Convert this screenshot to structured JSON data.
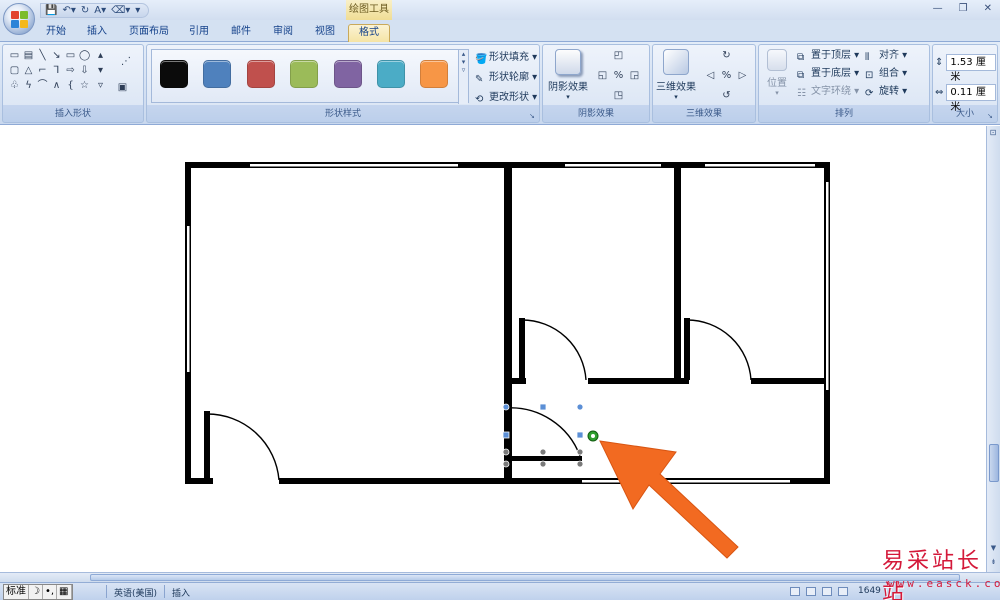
{
  "title_bar": {
    "context_tool_label": "绘图工具"
  },
  "tabs": [
    {
      "label": "开始"
    },
    {
      "label": "插入"
    },
    {
      "label": "页面布局"
    },
    {
      "label": "引用"
    },
    {
      "label": "邮件"
    },
    {
      "label": "审阅"
    },
    {
      "label": "视图"
    },
    {
      "label": "格式",
      "active": true
    }
  ],
  "ribbon": {
    "insert_shapes": {
      "label": "插入形状"
    },
    "shape_styles": {
      "label": "形状样式",
      "swatches": [
        "#0b0b0b",
        "#4f81bd",
        "#c0504d",
        "#9bbb59",
        "#8064a2",
        "#4bacc6",
        "#f79646"
      ],
      "fill_label": "形状填充",
      "outline_label": "形状轮廓",
      "change_label": "更改形状"
    },
    "shadow_effects": {
      "label": "阴影效果",
      "button_label": "阴影效果"
    },
    "threed_effects": {
      "label": "三维效果",
      "button_label": "三维效果"
    },
    "arrange": {
      "label": "排列",
      "position_label": "位置",
      "bring_front_label": "置于顶层",
      "send_back_label": "置于底层",
      "text_wrap_label": "文字环绕",
      "align_label": "对齐",
      "group_label": "组合",
      "rotate_label": "旋转"
    },
    "size": {
      "label": "大小",
      "height_value": "1.53 厘米",
      "width_value": "0.11 厘米"
    }
  },
  "status_bar": {
    "ime": [
      "标准",
      "☽",
      "•,",
      "▦"
    ],
    "language": "英语(美国)",
    "mode": "插入",
    "zoom_fragment": "1649"
  },
  "watermark": {
    "cn": "易采站长站",
    "url": "www.easck.com"
  },
  "colors": {
    "annotation_arrow": "#f26a21",
    "selection_handle": "#5b8fd6",
    "rotate_handle": "#2f9f2f"
  }
}
